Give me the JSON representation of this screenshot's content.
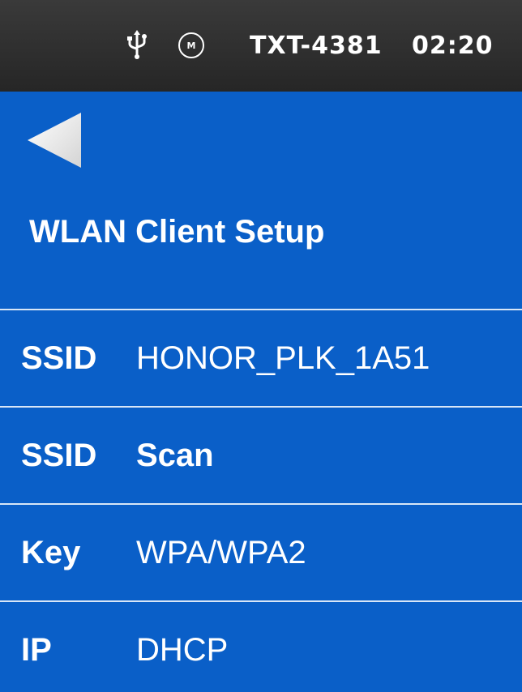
{
  "status_bar": {
    "usb_icon": "usb-icon",
    "motor_icon": "motor-icon",
    "motor_icon_letter": "M",
    "device_id": "TXT-4381",
    "time": "02:20"
  },
  "header": {
    "back_icon": "back-arrow-icon",
    "title": "WLAN Client Setup"
  },
  "rows": [
    {
      "label": "SSID",
      "value": "HONOR_PLK_1A51"
    },
    {
      "label": "SSID",
      "value": "Scan"
    },
    {
      "label": "Key",
      "value": "WPA/WPA2"
    },
    {
      "label": "IP",
      "value": "DHCP"
    }
  ],
  "colors": {
    "background": "#0a5fc8",
    "status_bar": "#2f2f2f",
    "divider": "#d8e6f7",
    "text": "#ffffff"
  }
}
